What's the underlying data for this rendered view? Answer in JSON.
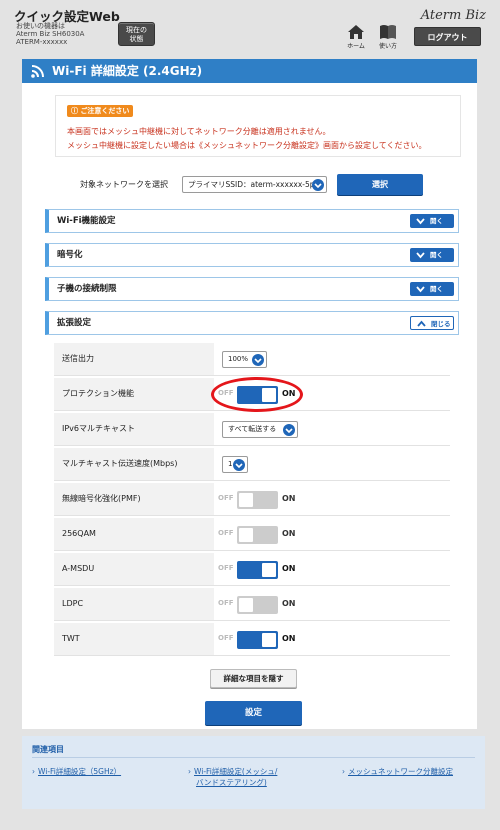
{
  "header": {
    "app_title": "クイック設定Web",
    "device_label": "お使いの機器は",
    "device_model": "Aterm Biz SH6030A",
    "device_ssid": "ATERM-xxxxxx",
    "status_button": "現在の\n状態",
    "status_line1": "現在の",
    "status_line2": "状態",
    "brand": "Aterm Biz",
    "home_label": "ホーム",
    "help_label": "使い方",
    "logout_label": "ログアウト"
  },
  "page": {
    "title": "Wi-Fi 詳細設定 (2.4GHz)"
  },
  "notice": {
    "badge": "ご注意ください",
    "line1": "本画面ではメッシュ中継機に対してネットワーク分離は適用されません。",
    "line2": "メッシュ中継機に設定したい場合は《メッシュネットワーク分離設定》画面から設定してください。"
  },
  "network": {
    "label": "対象ネットワークを選択",
    "selected": "プライマリSSID：aterm-xxxxxx-5p",
    "select_button": "選択"
  },
  "sections": [
    {
      "label": "Wi-Fi機能設定",
      "button": "開く"
    },
    {
      "label": "暗号化",
      "button": "開く"
    },
    {
      "label": "子機の接続制限",
      "button": "開く"
    },
    {
      "label": "拡張設定",
      "button": "閉じる"
    }
  ],
  "toggle_labels": {
    "off": "OFF",
    "on": "ON"
  },
  "settings": [
    {
      "label": "送信出力",
      "value": "100%"
    },
    {
      "label": "プロテクション機能",
      "state": "on"
    },
    {
      "label": "IPv6マルチキャスト",
      "value": "すべて転送する"
    },
    {
      "label": "マルチキャスト伝送速度(Mbps)",
      "value": "1"
    },
    {
      "label": "無線暗号化強化(PMF)",
      "state": "off"
    },
    {
      "label": "256QAM",
      "state": "off"
    },
    {
      "label": "A-MSDU",
      "state": "on"
    },
    {
      "label": "LDPC",
      "state": "off"
    },
    {
      "label": "TWT",
      "state": "on"
    }
  ],
  "actions": {
    "hide_details": "詳細な項目を隠す",
    "save": "設定"
  },
  "related": {
    "title": "関連項目",
    "links": [
      {
        "line1": "Wi-Fi詳細設定（5GHz）",
        "line2": ""
      },
      {
        "line1": "Wi-Fi詳細設定(メッシュ/",
        "line2": "バンドステアリング)"
      },
      {
        "line1": "メッシュネットワーク分離設定",
        "line2": ""
      }
    ]
  },
  "colors": {
    "accent": "#1f66b8",
    "title_bar": "#2f7fc6",
    "notice_text": "#c8321e",
    "highlight": "#e4161b"
  }
}
